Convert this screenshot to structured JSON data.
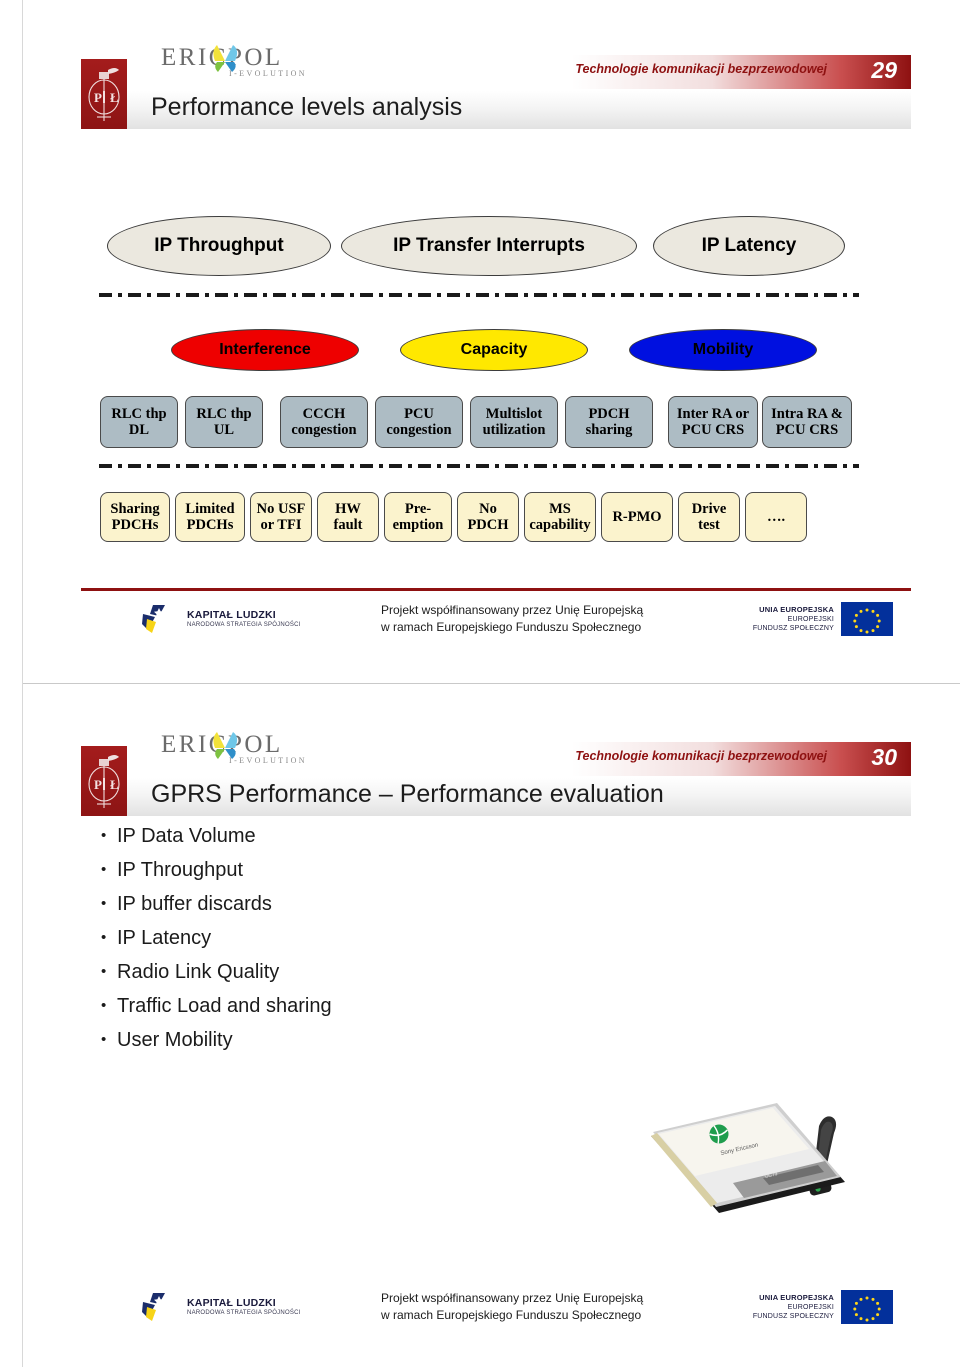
{
  "document": {
    "kind": "presentation-handout",
    "slide_count": 2
  },
  "brand": {
    "organization": "ERICPOL",
    "tagline": "I-EVOLUTION",
    "crest_label": "PŁ",
    "accent_red": "#8e1111",
    "crest_red": "#9e1a1a"
  },
  "slides": [
    {
      "page_number": "29",
      "topic": "Technologie komunikacji bezprzewodowej",
      "title": "Performance levels analysis",
      "diagram": {
        "level1": [
          {
            "label": "IP Throughput",
            "fill": "#ebe8df"
          },
          {
            "label": "IP Transfer Interrupts",
            "fill": "#ebe8df"
          },
          {
            "label": "IP Latency",
            "fill": "#ebe8df"
          }
        ],
        "level2": [
          {
            "label": "Interference",
            "fill": "#ee0000",
            "text_color": "#000000"
          },
          {
            "label": "Capacity",
            "fill": "#ffe800",
            "text_color": "#000000"
          },
          {
            "label": "Mobility",
            "fill": "#0010e0",
            "text_color": "#000000"
          }
        ],
        "level3": [
          {
            "line1": "RLC thp",
            "line2": "DL"
          },
          {
            "line1": "RLC thp",
            "line2": "UL"
          },
          {
            "line1": "CCCH",
            "line2": "congestion"
          },
          {
            "line1": "PCU",
            "line2": "congestion"
          },
          {
            "line1": "Multislot",
            "line2": "utilization"
          },
          {
            "line1": "PDCH",
            "line2": "sharing"
          },
          {
            "line1": "Inter RA or",
            "line2": "PCU CRS"
          },
          {
            "line1": "Intra RA &",
            "line2": "PCU CRS"
          }
        ],
        "level3_fill": "#adbcc4",
        "level4": [
          {
            "line1": "Sharing",
            "line2": "PDCHs"
          },
          {
            "line1": "Limited",
            "line2": "PDCHs"
          },
          {
            "line1": "No USF",
            "line2": "or TFI"
          },
          {
            "line1": "HW",
            "line2": "fault"
          },
          {
            "line1": "Pre-",
            "line2": "emption"
          },
          {
            "line1": "No",
            "line2": "PDCH"
          },
          {
            "line1": "MS",
            "line2": "capability"
          },
          {
            "line1": "R-PMO",
            "line2": ""
          },
          {
            "line1": "Drive",
            "line2": "test"
          },
          {
            "line1": "….",
            "line2": ""
          }
        ],
        "level4_fill": "#fbf3cd"
      }
    },
    {
      "page_number": "30",
      "topic": "Technologie komunikacji bezprzewodowej",
      "title": "GPRS Performance – Performance evaluation",
      "bullets": [
        "IP Data Volume",
        "IP Throughput",
        "IP buffer discards",
        "IP Latency",
        "Radio Link Quality",
        "Traffic Load and sharing",
        "User Mobility"
      ],
      "photo": {
        "caption": "Sony Ericsson PCMCIA wireless data card with antenna"
      }
    }
  ],
  "footer": {
    "kapital_ludzki": {
      "title": "KAPITAŁ LUDZKI",
      "subtitle": "NARODOWA STRATEGIA SPÓJNOŚCI"
    },
    "center_line1": "Projekt współfinansowany przez Unię Europejską",
    "center_line2": "w ramach Europejskiego Funduszu Społecznego",
    "eu": {
      "line1": "UNIA EUROPEJSKA",
      "line2": "EUROPEJSKI",
      "line3": "FUNDUSZ SPOŁECZNY"
    }
  }
}
